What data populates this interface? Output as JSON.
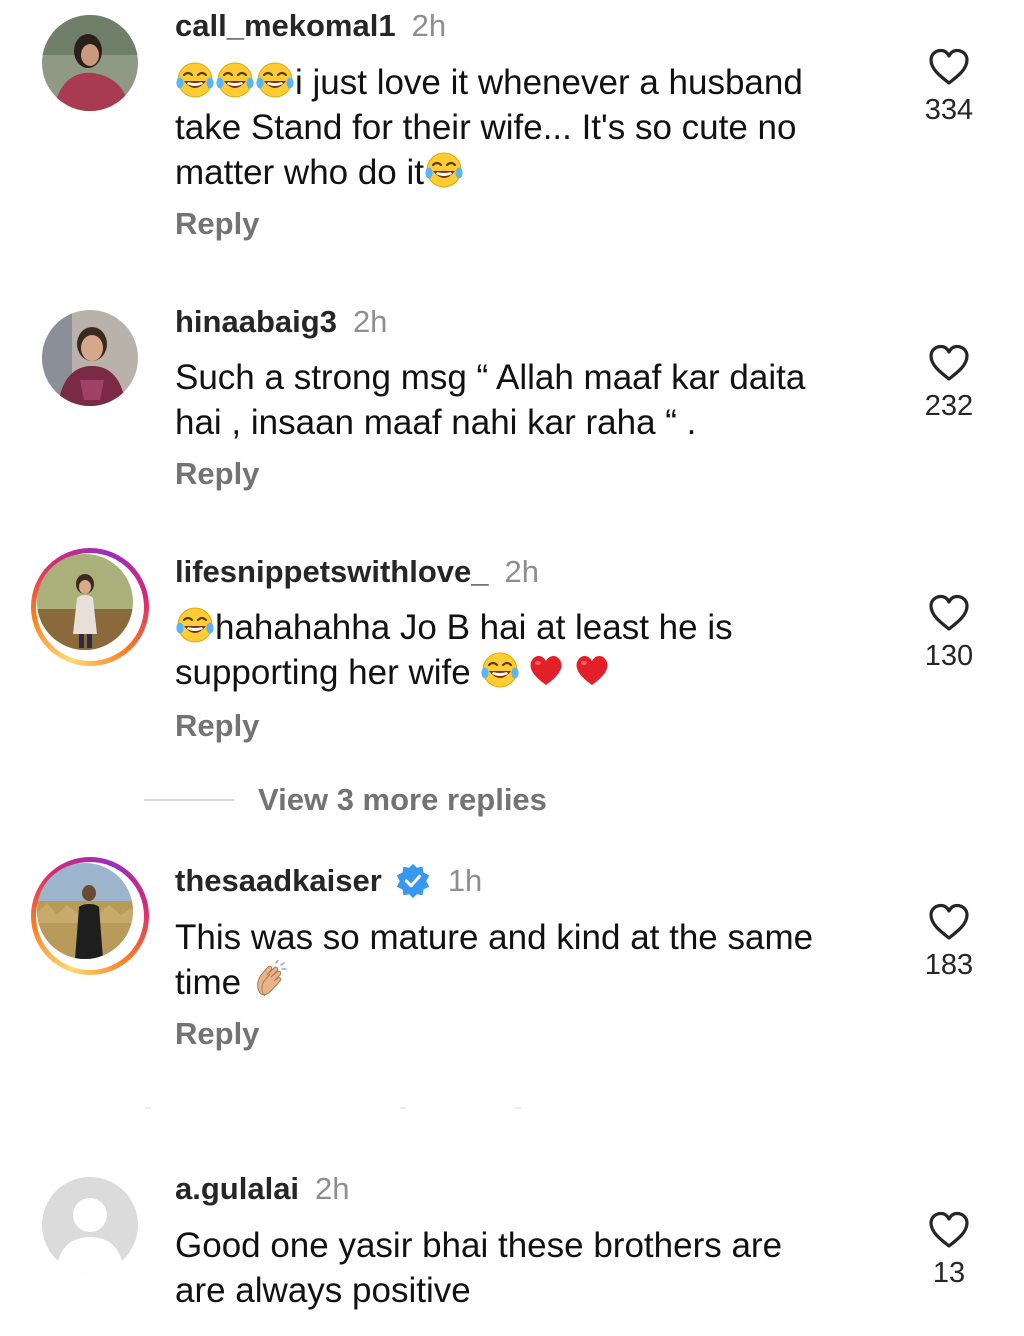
{
  "comments": [
    {
      "username": "call_mekomal1",
      "time": "2h",
      "text_line1": "i just love it whenever a husband",
      "text_line2": "take Stand for their wife... It's so cute no",
      "text_line3": "matter who do it",
      "reply": "Reply",
      "likes": "334"
    },
    {
      "username": "hinaabaig3",
      "time": "2h",
      "text_line1": "Such a strong msg “ Allah maaf kar daita",
      "text_line2": "hai , insaan maaf nahi kar raha “ .",
      "reply": "Reply",
      "likes": "232"
    },
    {
      "username": "lifesnippetswithlove_",
      "time": "2h",
      "text_line1": "hahahahha Jo B hai at least he is",
      "text_line2": "supporting her wife ",
      "reply": "Reply",
      "likes": "130"
    },
    {
      "username": "thesaadkaiser",
      "time": "1h",
      "verified": true,
      "text_line1": "This was so mature and kind at the same",
      "text_line2": "time ",
      "reply": "Reply",
      "likes": "183"
    },
    {
      "username": "a.gulalai",
      "time": "2h",
      "text_line1": "Good one yasir bhai these brothers are",
      "text_line2": "are always positive",
      "likes": "13"
    }
  ],
  "view_more_replies": "View 3 more replies",
  "icons": {
    "like": "heart-outline-icon",
    "laugh": "face-with-tears-of-joy-icon",
    "red_heart": "red-heart-icon",
    "clap": "clapping-hands-icon",
    "verified": "verified-badge-icon"
  },
  "colors": {
    "username": "#262626",
    "secondary": "#8e8e8e",
    "reply": "#737373",
    "verified": "#3897f0"
  }
}
